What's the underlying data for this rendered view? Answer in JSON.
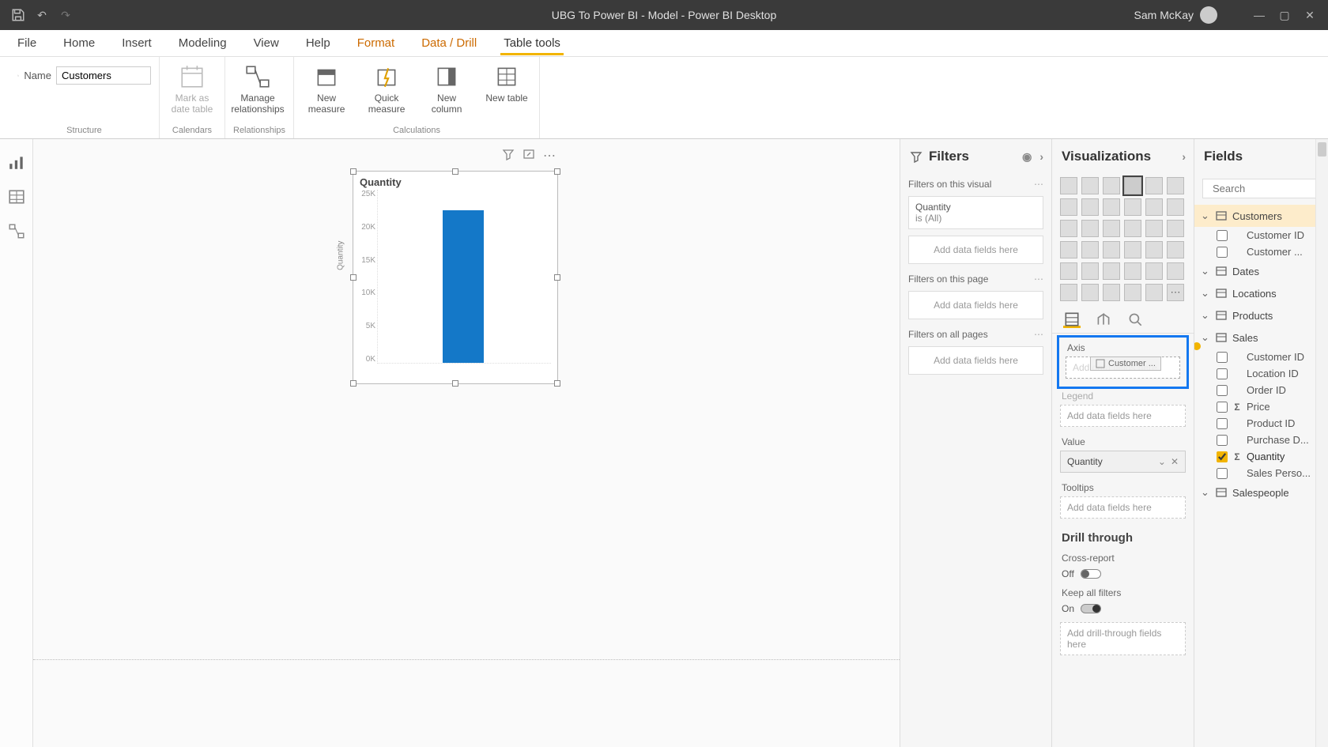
{
  "titlebar": {
    "title": "UBG To Power BI - Model - Power BI Desktop",
    "user": "Sam McKay"
  },
  "menu": {
    "file": "File",
    "home": "Home",
    "insert": "Insert",
    "modeling": "Modeling",
    "view": "View",
    "help": "Help",
    "format": "Format",
    "datadrill": "Data / Drill",
    "tabletools": "Table tools"
  },
  "ribbon": {
    "name_label": "Name",
    "name_value": "Customers",
    "mark_as_date": "Mark as date table",
    "manage_rel": "Manage relationships",
    "new_measure": "New measure",
    "quick_measure": "Quick measure",
    "new_column": "New column",
    "new_table": "New table",
    "g_structure": "Structure",
    "g_calendars": "Calendars",
    "g_relationships": "Relationships",
    "g_calculations": "Calculations"
  },
  "visual": {
    "title": "Quantity",
    "yaxis_title": "Quantity"
  },
  "chart_data": {
    "type": "bar",
    "categories": [
      ""
    ],
    "values": [
      22000
    ],
    "title": "Quantity",
    "xlabel": "",
    "ylabel": "Quantity",
    "ylim": [
      0,
      25000
    ],
    "yticks": [
      "25K",
      "20K",
      "15K",
      "10K",
      "5K",
      "0K"
    ]
  },
  "filters": {
    "header": "Filters",
    "on_visual": "Filters on this visual",
    "chip_name": "Quantity",
    "chip_sub": "is (All)",
    "add": "Add data fields here",
    "on_page": "Filters on this page",
    "on_all": "Filters on all pages"
  },
  "viz": {
    "header": "Visualizations",
    "axis": "Axis",
    "axis_placeholder": "Add data fields here",
    "axis_drag": "Customer ...",
    "legend": "Legend",
    "legend_placeholder": "Add data fields here",
    "value": "Value",
    "value_chip": "Quantity",
    "tooltips": "Tooltips",
    "tooltips_placeholder": "Add data fields here",
    "drill_header": "Drill through",
    "cross_report": "Cross-report",
    "off": "Off",
    "keep_filters": "Keep all filters",
    "on": "On",
    "drill_placeholder": "Add drill-through fields here"
  },
  "fields": {
    "header": "Fields",
    "search_placeholder": "Search",
    "tables": {
      "customers": {
        "label": "Customers",
        "items": [
          "Customer ID",
          "Customer ..."
        ]
      },
      "dates": {
        "label": "Dates"
      },
      "locations": {
        "label": "Locations"
      },
      "products": {
        "label": "Products"
      },
      "sales": {
        "label": "Sales",
        "items": [
          "Customer ID",
          "Location ID",
          "Order ID",
          "Price",
          "Product ID",
          "Purchase D...",
          "Quantity",
          "Sales Perso..."
        ]
      },
      "salespeople": {
        "label": "Salespeople"
      }
    }
  }
}
